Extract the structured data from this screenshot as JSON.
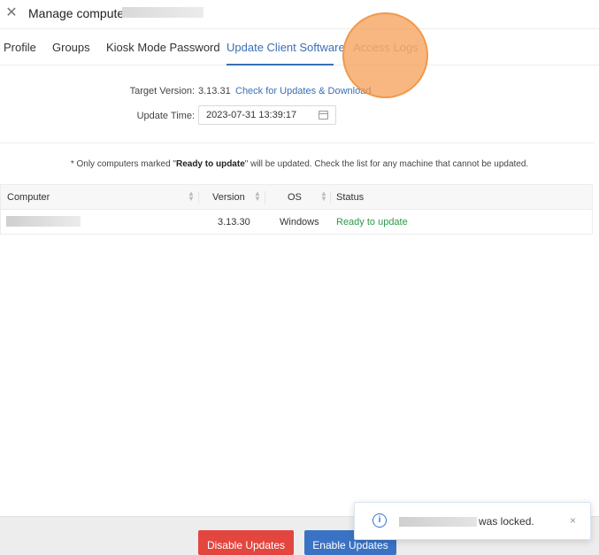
{
  "header": {
    "close_glyph": "✕",
    "title": "Manage computer:"
  },
  "tabs": [
    {
      "label": "Profile",
      "active": false
    },
    {
      "label": "Groups",
      "active": false
    },
    {
      "label": "Kiosk Mode Password",
      "active": false
    },
    {
      "label": "Update Client Software",
      "active": true
    },
    {
      "label": "Access Logs",
      "active": false
    }
  ],
  "form": {
    "target_version_label": "Target Version:",
    "target_version_value": "3.13.31",
    "check_link": "Check for Updates & Download",
    "update_time_label": "Update Time:",
    "update_time_value": "2023-07-31 13:39:17"
  },
  "note": {
    "prefix": "* Only computers marked \"",
    "bold": "Ready to update",
    "suffix": "\" will be updated. Check the list for any machine that cannot be updated."
  },
  "table": {
    "columns": [
      "Computer",
      "Version",
      "OS",
      "Status"
    ],
    "rows": [
      {
        "computer": "",
        "version": "3.13.30",
        "os": "Windows",
        "status": "Ready to update"
      }
    ]
  },
  "footer": {
    "disable_label": "Disable Updates",
    "enable_label": "Enable Updates"
  },
  "toast": {
    "icon": "info-icon",
    "message": "was locked.",
    "close_glyph": "×"
  },
  "colors": {
    "accent": "#3a6fb5",
    "danger": "#e2463f",
    "primary_button": "#3a73c4",
    "status_ok": "#2e9a46",
    "cursor_highlight": "#f59b50"
  }
}
